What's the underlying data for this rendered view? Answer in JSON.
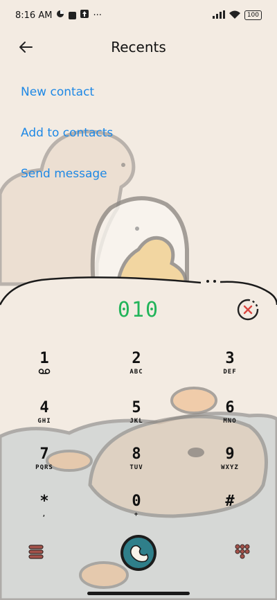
{
  "status_bar": {
    "time": "8:16 AM",
    "more": "···",
    "battery": "100"
  },
  "header": {
    "title": "Recents"
  },
  "actions": {
    "new_contact": "New contact",
    "add_to_contacts": "Add to contacts",
    "send_message": "Send message"
  },
  "dialer": {
    "number": "010",
    "keys": [
      {
        "digit": "1",
        "letters": ""
      },
      {
        "digit": "2",
        "letters": "ABC"
      },
      {
        "digit": "3",
        "letters": "DEF"
      },
      {
        "digit": "4",
        "letters": "GHI"
      },
      {
        "digit": "5",
        "letters": "JKL"
      },
      {
        "digit": "6",
        "letters": "MNO"
      },
      {
        "digit": "7",
        "letters": "PQRS"
      },
      {
        "digit": "8",
        "letters": "TUV"
      },
      {
        "digit": "9",
        "letters": "WXYZ"
      },
      {
        "digit": "*",
        "letters": ","
      },
      {
        "digit": "0",
        "letters": "+"
      },
      {
        "digit": "#",
        "letters": ""
      }
    ]
  },
  "colors": {
    "accent_blue": "#1e88e5",
    "number_green": "#22b45a",
    "clear_red": "#d9453f",
    "call_teal": "#2f7f8a"
  },
  "icons": {
    "back": "arrow-left-icon",
    "clear": "clear-x-icon",
    "voicemail": "voicemail-icon",
    "menu": "menu-icon",
    "call": "call-icon",
    "keypad": "keypad-icon"
  }
}
